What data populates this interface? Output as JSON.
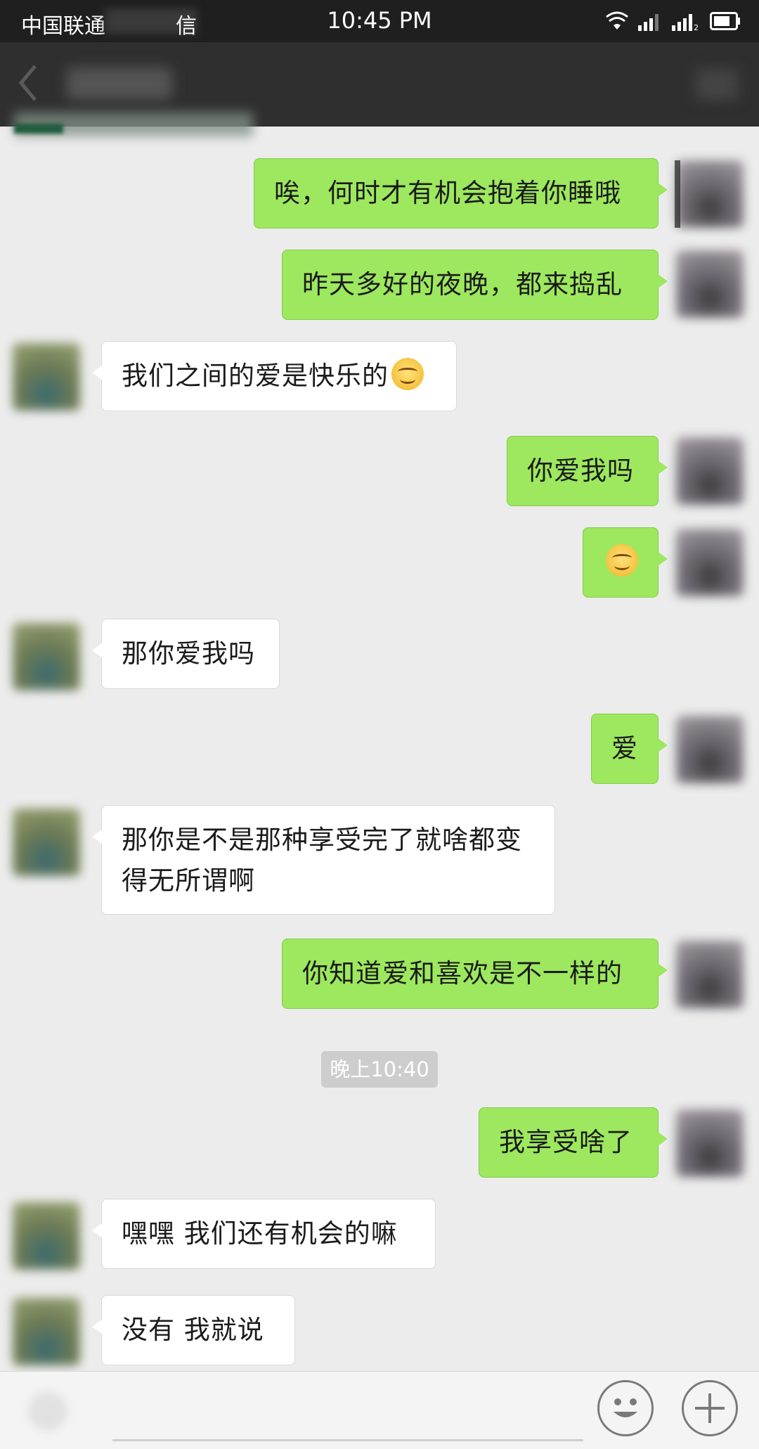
{
  "status_bar": {
    "carrier": "中国联通",
    "carrier_extra": "信",
    "time": "10:45 PM",
    "icons": [
      "wifi-icon",
      "signal-icon",
      "signal-2-icon",
      "battery-icon"
    ]
  },
  "header": {
    "back_icon": "chevron-left-icon"
  },
  "messages": [
    {
      "side": "me",
      "text": "唉，何时才有机会抱着你睡哦"
    },
    {
      "side": "me",
      "text": "昨天多好的夜晚，都来捣乱"
    },
    {
      "side": "other",
      "text": "我们之间的爱是快乐的",
      "emoji": "smile-emoji"
    },
    {
      "side": "me",
      "text": "你爱我吗"
    },
    {
      "side": "me",
      "text": "",
      "emoji": "smile-emoji"
    },
    {
      "side": "other",
      "text": "那你爱我吗"
    },
    {
      "side": "me",
      "text": "爱"
    },
    {
      "side": "other",
      "text_line1": "那你是不是那种享受完了就啥都变",
      "text_line2": "得无所谓啊"
    },
    {
      "side": "me",
      "text": "你知道爱和喜欢是不一样的"
    },
    {
      "side": "me",
      "text": "我享受啥了"
    },
    {
      "side": "other",
      "text": "嘿嘿  我们还有机会的嘛"
    },
    {
      "side": "other",
      "text": "没有  我就说"
    }
  ],
  "timestamp": "晚上10:40",
  "input_bar": {
    "emoji_icon": "emoji-face-icon",
    "plus_icon": "plus-icon"
  },
  "colors": {
    "my_bubble": "#9de85e",
    "other_bubble": "#ffffff",
    "background": "#ececec",
    "header": "#2f2f2f"
  }
}
